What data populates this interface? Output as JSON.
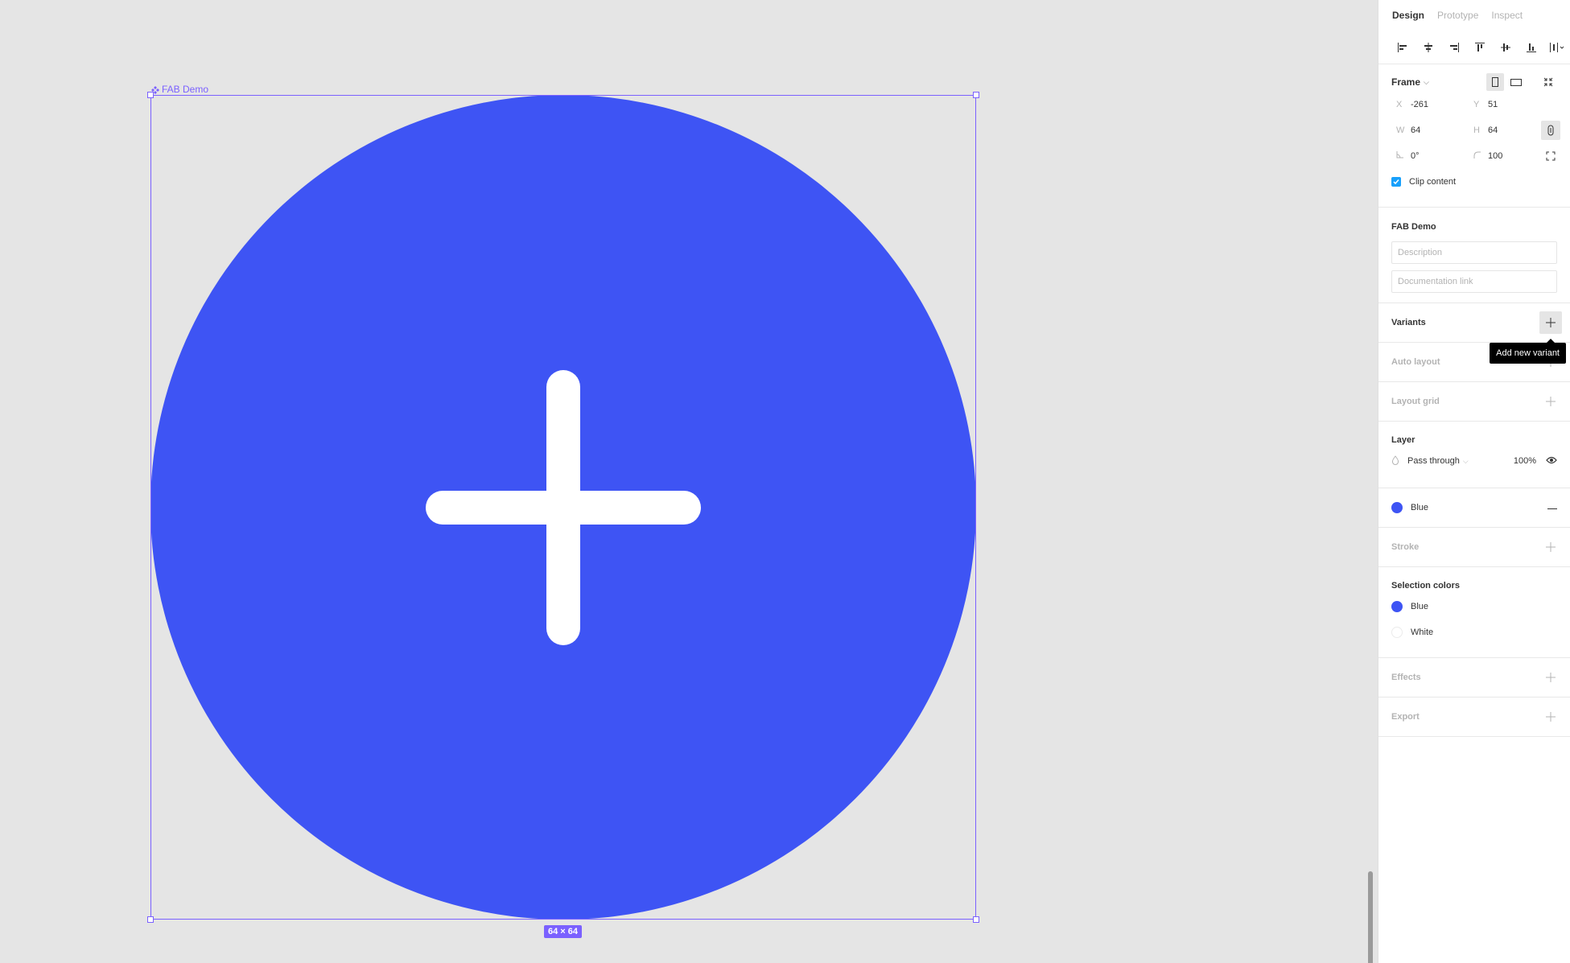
{
  "canvas": {
    "frame_label": "FAB Demo",
    "size_badge": "64 × 64",
    "fill_color": "#3e54f4",
    "selection_color": "#7b61ff"
  },
  "panel": {
    "tabs": [
      {
        "label": "Design",
        "active": true
      },
      {
        "label": "Prototype",
        "active": false
      },
      {
        "label": "Inspect",
        "active": false
      }
    ],
    "align_tools": [
      "align-left",
      "align-horizontal-center",
      "align-right",
      "align-top",
      "align-vertical-center",
      "align-bottom",
      "distribute"
    ],
    "frame": {
      "title": "Frame",
      "x_label": "X",
      "x": "-261",
      "y_label": "Y",
      "y": "51",
      "w_label": "W",
      "w": "64",
      "h_label": "H",
      "h": "64",
      "rotation": "0°",
      "radius": "100",
      "clip_content_label": "Clip content",
      "clip_content": true
    },
    "component": {
      "title": "FAB Demo",
      "description_placeholder": "Description",
      "doc_link_placeholder": "Documentation link"
    },
    "variants": {
      "title": "Variants",
      "tooltip": "Add new variant"
    },
    "auto_layout": {
      "title": "Auto layout"
    },
    "layout_grid": {
      "title": "Layout grid"
    },
    "layer": {
      "title": "Layer",
      "blend": "Pass through",
      "opacity": "100%"
    },
    "fill": {
      "name": "Blue",
      "color": "#3e54f4"
    },
    "stroke": {
      "title": "Stroke"
    },
    "selection_colors": {
      "title": "Selection colors",
      "items": [
        {
          "name": "Blue",
          "color": "#3e54f4"
        },
        {
          "name": "White",
          "color": "#ffffff"
        }
      ]
    },
    "effects": {
      "title": "Effects"
    },
    "export": {
      "title": "Export"
    }
  }
}
